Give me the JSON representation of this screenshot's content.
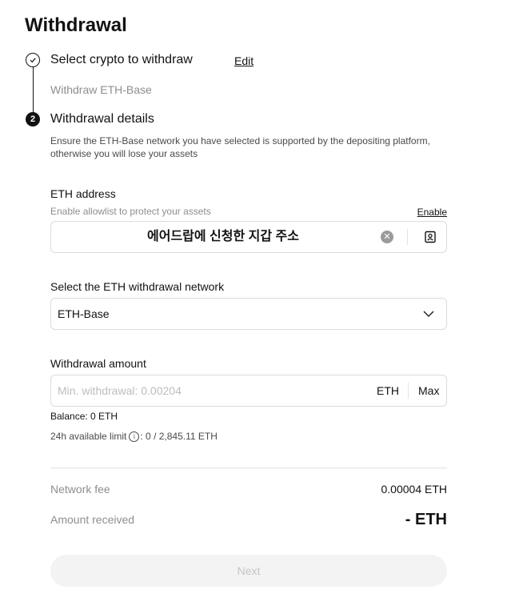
{
  "page": {
    "title": "Withdrawal"
  },
  "step1": {
    "title": "Select crypto to withdraw",
    "edit_label": "Edit",
    "summary": "Withdraw ETH-Base"
  },
  "step2": {
    "number": "2",
    "title": "Withdrawal details",
    "warning": "Ensure the ETH-Base network you have selected is supported by the depositing platform, otherwise you will lose your assets"
  },
  "address": {
    "label": "ETH address",
    "hint": "Enable allowlist to protect your assets",
    "enable_label": "Enable",
    "value": "에어드랍에 신청한 지갑 주소"
  },
  "network": {
    "label": "Select the ETH withdrawal network",
    "selected": "ETH-Base"
  },
  "amount": {
    "label": "Withdrawal amount",
    "placeholder": "Min. withdrawal: 0.00204",
    "unit": "ETH",
    "max_label": "Max",
    "balance": "Balance: 0 ETH",
    "limit_label": "24h available limit",
    "limit_value": ": 0 / 2,845.11 ETH"
  },
  "summary": {
    "fee_label": "Network fee",
    "fee_value": "0.00004 ETH",
    "received_label": "Amount received",
    "received_value": "- ETH"
  },
  "next_label": "Next"
}
